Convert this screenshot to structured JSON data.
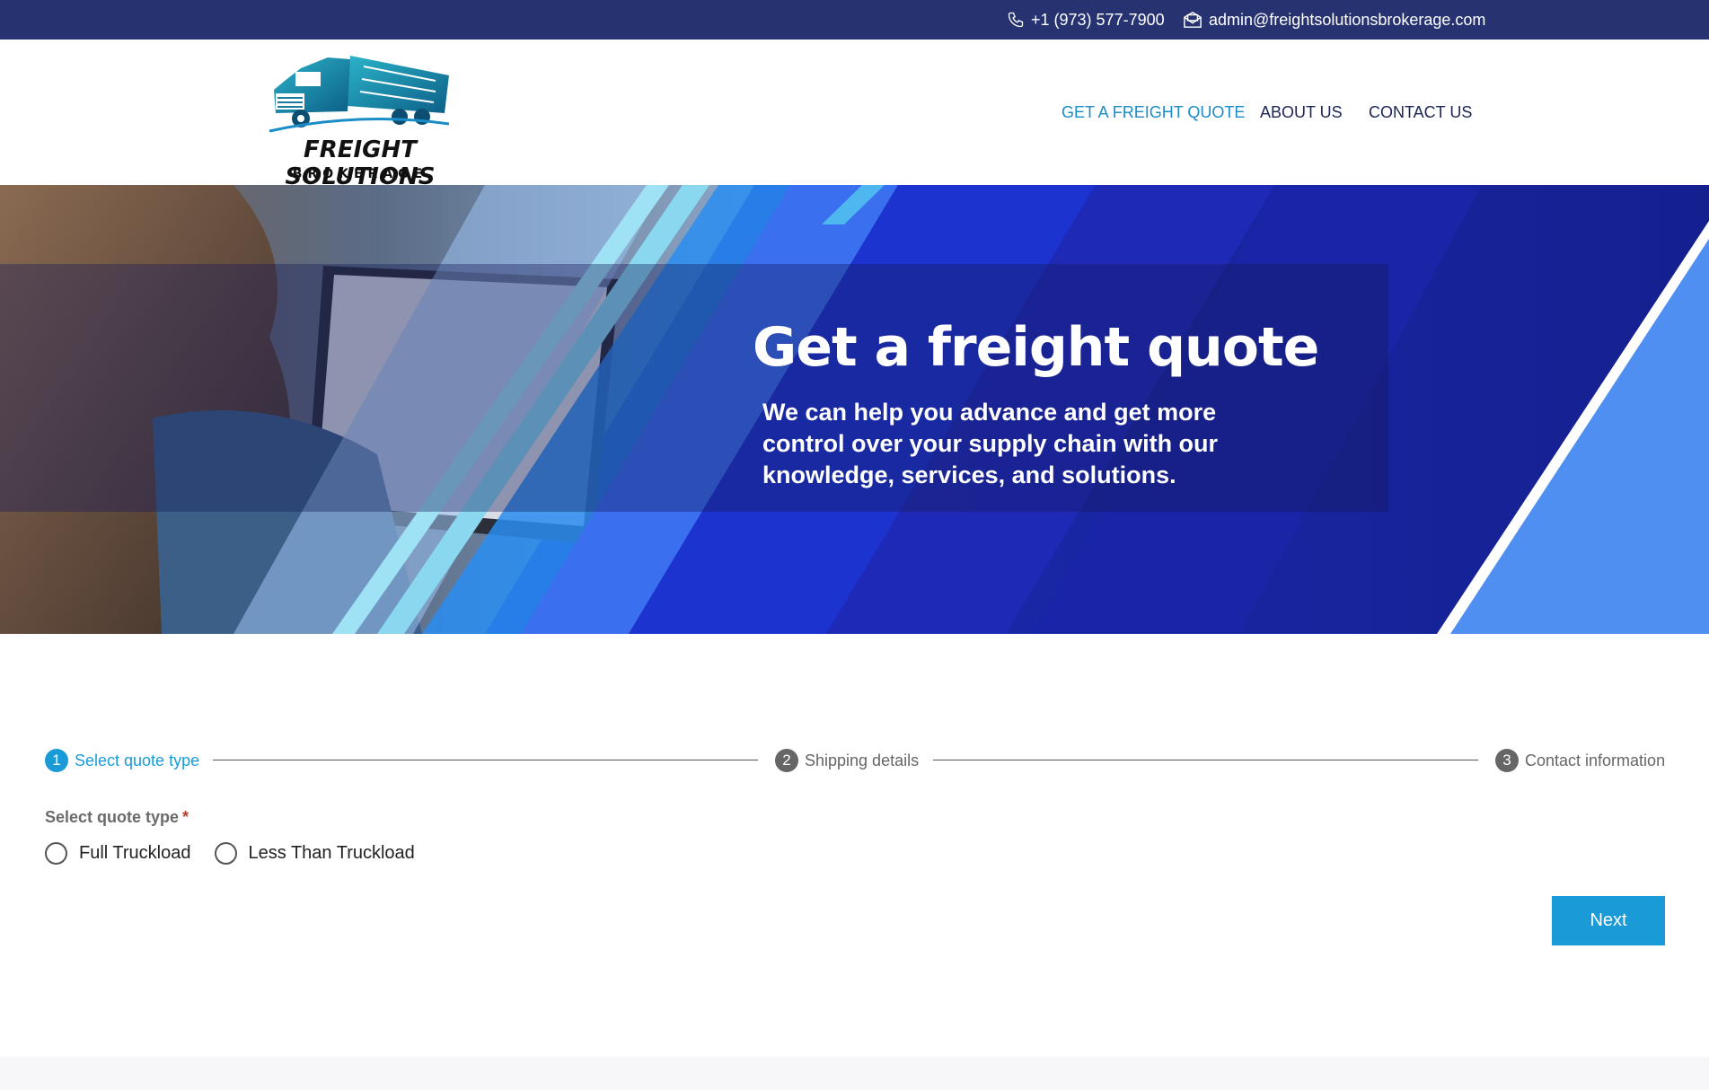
{
  "topbar": {
    "phone": "+1 (973) 577-7900",
    "email": "admin@freightsolutionsbrokerage.com"
  },
  "header": {
    "logo_line1": "FREIGHT SOLUTIONS",
    "logo_line2": "BROKERAGE",
    "nav": {
      "quote": "GET A FREIGHT QUOTE",
      "about": "ABOUT US",
      "contact": "CONTACT US"
    }
  },
  "hero": {
    "title": "Get a freight quote",
    "subtitle": "We can help you advance and get more control over your supply chain with our knowledge, services, and solutions."
  },
  "stepper": {
    "steps": [
      {
        "num": "1",
        "label": "Select quote type",
        "active": true
      },
      {
        "num": "2",
        "label": "Shipping details",
        "active": false
      },
      {
        "num": "3",
        "label": "Contact information",
        "active": false
      }
    ]
  },
  "form": {
    "label": "Select quote type",
    "required_mark": "*",
    "options": [
      "Full Truckload",
      "Less Than Truckload"
    ],
    "next_label": "Next"
  },
  "colors": {
    "topbar": "#273371",
    "accent": "#1a9bd7",
    "nav_active": "#1a8cc8",
    "hero_blue": "#1a2bb5"
  }
}
